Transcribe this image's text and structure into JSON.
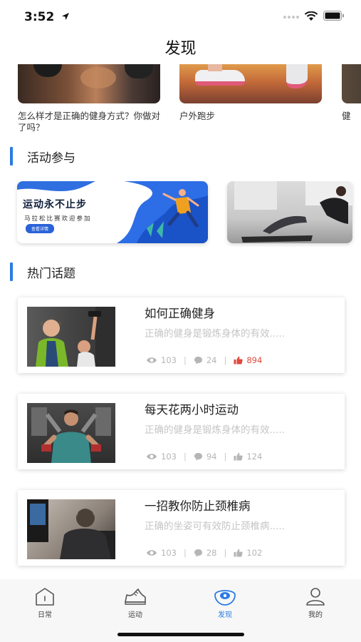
{
  "status_bar": {
    "time": "3:52"
  },
  "nav": {
    "title": "发现"
  },
  "top_articles": [
    {
      "caption": "怎么样才是正确的健身方式？你做对了吗？"
    },
    {
      "caption": "户外跑步"
    },
    {
      "caption": "健"
    }
  ],
  "sections": {
    "activities": "活动参与",
    "hot_topics": "热门话题"
  },
  "activity_banner": {
    "title": "运动永不止步",
    "subtitle": "马拉松比赛欢迎参加",
    "button": "查看详情"
  },
  "topics": [
    {
      "title": "如何正确健身",
      "desc": "正确的健身是锻炼身体的有效.....",
      "views": "103",
      "comments": "24",
      "likes": "894",
      "liked": true
    },
    {
      "title": "每天花两小时运动",
      "desc": "正确的健身是锻炼身体的有效.....",
      "views": "103",
      "comments": "94",
      "likes": "124",
      "liked": false
    },
    {
      "title": "一招教你防止颈椎病",
      "desc": "正确的坐姿可有效防止颈椎病.....",
      "views": "103",
      "comments": "28",
      "likes": "102",
      "liked": false
    }
  ],
  "tabbar": [
    {
      "label": "日常",
      "icon": "home-icon"
    },
    {
      "label": "运动",
      "icon": "sneaker-icon"
    },
    {
      "label": "发现",
      "icon": "discover-icon",
      "active": true
    },
    {
      "label": "我的",
      "icon": "profile-icon"
    }
  ],
  "colors": {
    "accent": "#2a7be4",
    "like": "#e0483e",
    "muted": "#c5c5c5"
  }
}
